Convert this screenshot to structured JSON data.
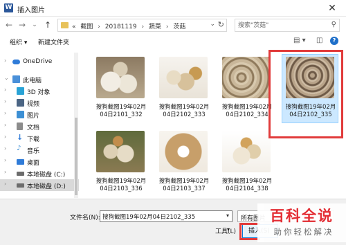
{
  "window": {
    "title": "插入图片",
    "app_icon_letter": "W",
    "close_glyph": "✕"
  },
  "nav": {
    "back_glyph": "←",
    "forward_glyph": "→",
    "recent_glyph": "⌄",
    "up_glyph": "↑",
    "crumb_overflow": "«",
    "breadcrumb": [
      "截图",
      "20181119",
      "蔬菜",
      "茨菇"
    ],
    "separator": "›",
    "dropdown_glyph": "⌄",
    "refresh_glyph": "↻",
    "search_placeholder": "搜索\"茨菇\"",
    "search_glyph": "⚲"
  },
  "toolbar": {
    "organize_label": "组织 ▾",
    "new_folder_label": "新建文件夹",
    "view_glyph": "▤ ▾",
    "pane_glyph": "◫",
    "help_glyph": "?"
  },
  "sidebar": {
    "items": [
      {
        "label": "OneDrive",
        "icon": "cloud-icon",
        "color": "#2f7bd8"
      },
      {
        "label": "此电脑",
        "icon": "computer-icon",
        "color": "#4a90d9"
      },
      {
        "label": "3D 对象",
        "icon": "cube-icon",
        "color": "#29a3d6"
      },
      {
        "label": "视频",
        "icon": "video-icon",
        "color": "#4b6584"
      },
      {
        "label": "图片",
        "icon": "pictures-icon",
        "color": "#3c8fd4"
      },
      {
        "label": "文档",
        "icon": "document-icon",
        "color": "#8c8c8c"
      },
      {
        "label": "下载",
        "icon": "download-icon",
        "color": "#2f7bd8"
      },
      {
        "label": "音乐",
        "icon": "music-icon",
        "color": "#3c8fd4"
      },
      {
        "label": "桌面",
        "icon": "desktop-icon",
        "color": "#2f7bd8"
      },
      {
        "label": "本地磁盘 (C:)",
        "icon": "drive-icon",
        "color": "#6c6c6c"
      },
      {
        "label": "本地磁盘 (D:)",
        "icon": "drive-icon",
        "color": "#6c6c6c"
      }
    ],
    "selected_index": 10
  },
  "files": [
    {
      "name": "搜狗截图19年02月04日2101_332",
      "selected": false
    },
    {
      "name": "搜狗截图19年02月04日2102_333",
      "selected": false
    },
    {
      "name": "搜狗截图19年02月04日2102_334",
      "selected": false
    },
    {
      "name": "搜狗截图19年02月04日2102_335",
      "selected": true
    },
    {
      "name": "搜狗截图19年02月04日2103_336",
      "selected": false
    },
    {
      "name": "搜狗截图19年02月04日2103_337",
      "selected": false
    },
    {
      "name": "搜狗截图19年02月04日2104_338",
      "selected": false
    }
  ],
  "footer": {
    "filename_label": "文件名(N):",
    "filename_value": "搜狗截图19年02月04日2102_335",
    "filename_dd": "▾",
    "filetype_value": "所有图片",
    "tools_label": "工具(L)",
    "tools_dd": "▾",
    "insert_label": "插入(S)"
  },
  "watermark": {
    "title": "百科全说",
    "subtitle": "助你轻松解决"
  },
  "colors": {
    "accent": "#0078d7",
    "highlight": "#e13b3b",
    "selection": "#cce8ff"
  }
}
